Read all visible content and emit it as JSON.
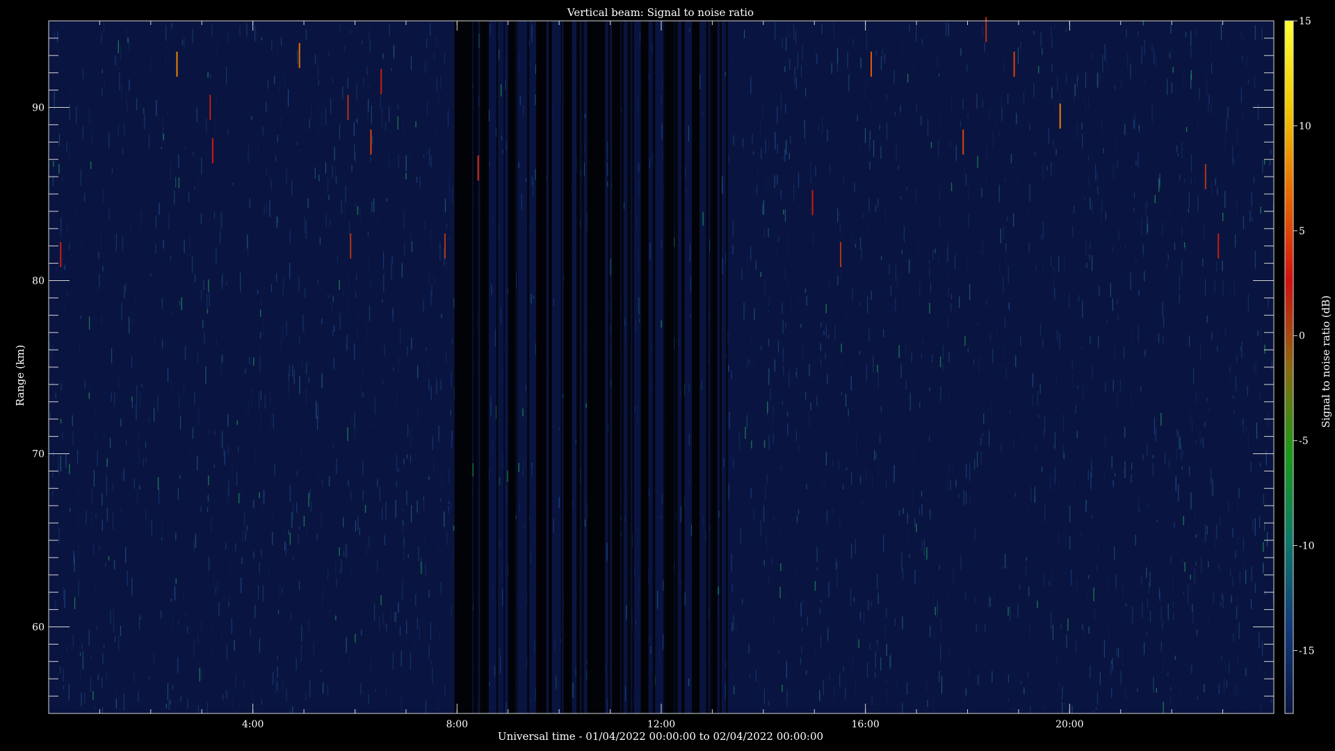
{
  "chart_data": {
    "type": "heatmap",
    "title": "Vertical beam: Signal to noise ratio",
    "xlabel": "Universal time - 01/04/2022 00:00:00 to 02/04/2022 00:00:00",
    "ylabel": "Range (km)",
    "colorbar_label": "Signal to noise ratio (dB)",
    "x_unit": "hours UT",
    "xlim": [
      0,
      24
    ],
    "ylim": [
      55,
      95
    ],
    "x_ticks": [
      {
        "value": 4,
        "label": "4:00"
      },
      {
        "value": 8,
        "label": "8:00"
      },
      {
        "value": 12,
        "label": "12:00"
      },
      {
        "value": 16,
        "label": "16:00"
      },
      {
        "value": 20,
        "label": "20:00"
      }
    ],
    "y_ticks": [
      {
        "value": 60,
        "label": "60"
      },
      {
        "value": 70,
        "label": "70"
      },
      {
        "value": 80,
        "label": "80"
      },
      {
        "value": 90,
        "label": "90"
      }
    ],
    "colorbar_range": [
      -18,
      15
    ],
    "colorbar_ticks": [
      {
        "value": 15,
        "label": "15"
      },
      {
        "value": 10,
        "label": "10"
      },
      {
        "value": 5,
        "label": "5"
      },
      {
        "value": 0,
        "label": "0"
      },
      {
        "value": -5,
        "label": "-5"
      },
      {
        "value": -10,
        "label": "-10"
      },
      {
        "value": -15,
        "label": "-15"
      }
    ],
    "colormap": [
      "#0a1440",
      "#123a7a",
      "#0d7a6a",
      "#1a9a1a",
      "#8a6a10",
      "#d01010",
      "#e86a00",
      "#f0c800",
      "#ffff30"
    ],
    "data_gaps_hours": [
      [
        7.95,
        8.3
      ],
      [
        8.45,
        8.62
      ],
      [
        9.0,
        9.15
      ],
      [
        9.55,
        9.75
      ],
      [
        10.1,
        10.25
      ],
      [
        10.55,
        10.9
      ],
      [
        11.05,
        11.2
      ],
      [
        11.6,
        11.75
      ],
      [
        12.1,
        12.25
      ],
      [
        12.6,
        12.75
      ],
      [
        13.0,
        13.1
      ]
    ],
    "notable_echoes": [
      {
        "time": 0.22,
        "range_km": 81.5,
        "snr_db": 3
      },
      {
        "time": 2.5,
        "range_km": 92.5,
        "snr_db": 8
      },
      {
        "time": 3.15,
        "range_km": 90,
        "snr_db": 2
      },
      {
        "time": 3.2,
        "range_km": 87.5,
        "snr_db": 3
      },
      {
        "time": 4.9,
        "range_km": 93,
        "snr_db": 7
      },
      {
        "time": 5.85,
        "range_km": 90,
        "snr_db": 1
      },
      {
        "time": 6.5,
        "range_km": 91.5,
        "snr_db": 2
      },
      {
        "time": 6.3,
        "range_km": 88,
        "snr_db": 5
      },
      {
        "time": 5.9,
        "range_km": 82,
        "snr_db": 1
      },
      {
        "time": 7.75,
        "range_km": 82,
        "snr_db": 1
      },
      {
        "time": 8.4,
        "range_km": 86.5,
        "snr_db": 4
      },
      {
        "time": 14.95,
        "range_km": 84.5,
        "snr_db": 3
      },
      {
        "time": 15.5,
        "range_km": 81.5,
        "snr_db": 1
      },
      {
        "time": 16.1,
        "range_km": 92.5,
        "snr_db": 6
      },
      {
        "time": 18.35,
        "range_km": 94.5,
        "snr_db": 1
      },
      {
        "time": 18.9,
        "range_km": 92.5,
        "snr_db": 5
      },
      {
        "time": 19.8,
        "range_km": 89.5,
        "snr_db": 8
      },
      {
        "time": 17.9,
        "range_km": 88,
        "snr_db": 5
      },
      {
        "time": 22.65,
        "range_km": 86,
        "snr_db": 1
      },
      {
        "time": 22.9,
        "range_km": 82,
        "snr_db": 2
      }
    ],
    "grid": false,
    "legend": "colorbar-right"
  }
}
